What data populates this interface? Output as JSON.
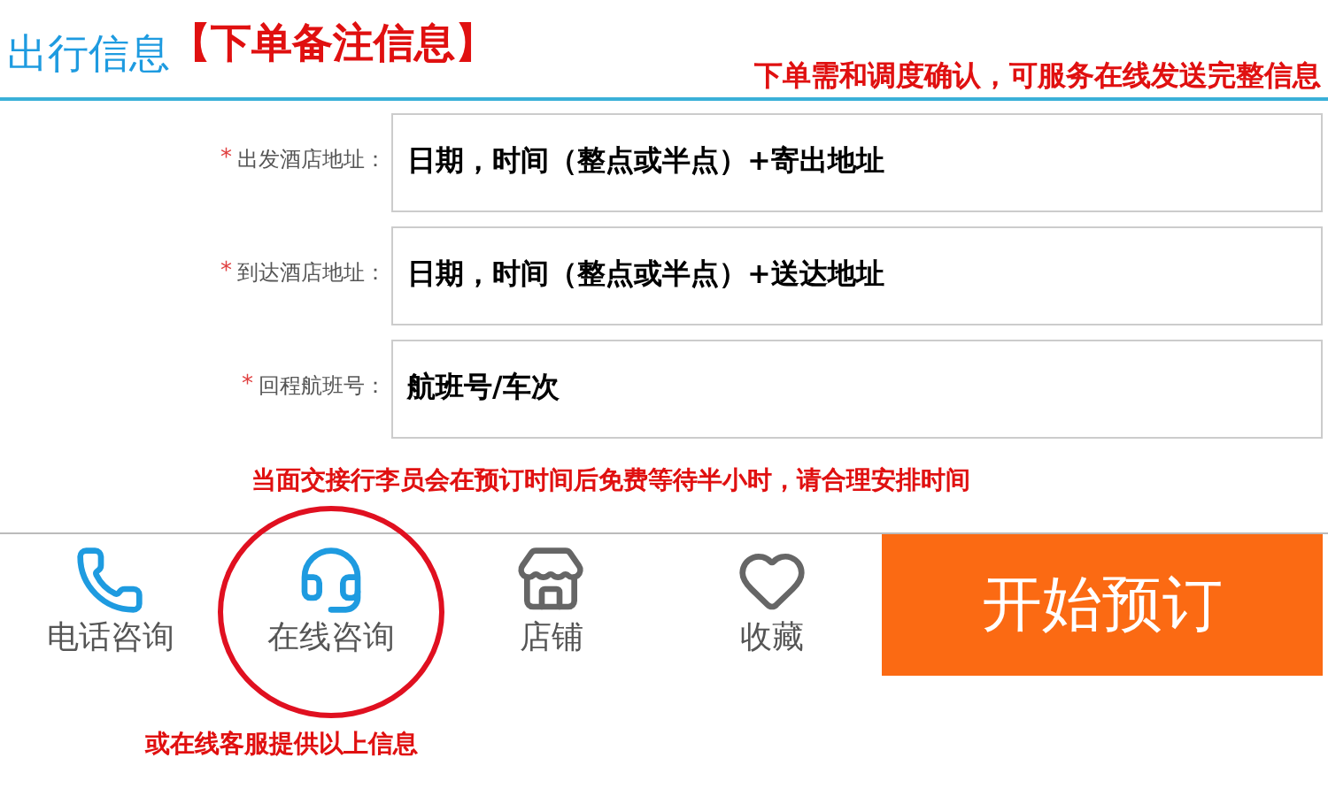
{
  "header": {
    "title": "出行信息",
    "subtitle": "【下单备注信息】",
    "note": "下单需和调度确认，可服务在线发送完整信息"
  },
  "fields": [
    {
      "required_mark": "*",
      "label": "出发酒店地址：",
      "value": "日期，时间（整点或半点）+寄出地址"
    },
    {
      "required_mark": "*",
      "label": "到达酒店地址：",
      "value": "日期，时间（整点或半点）+送达地址"
    },
    {
      "required_mark": "*",
      "label": "回程航班号：",
      "value": "航班号/车次"
    }
  ],
  "notice": "当面交接行李员会在预订时间后免费等待半小时，请合理安排时间",
  "bottom_bar": {
    "items": [
      {
        "kind": "phone",
        "label": "电话咨询",
        "circled": false
      },
      {
        "kind": "headset",
        "label": "在线咨询",
        "circled": true
      },
      {
        "kind": "store",
        "label": "店铺",
        "circled": false
      },
      {
        "kind": "heart",
        "label": "收藏",
        "circled": false
      }
    ],
    "book_button": "开始预订"
  },
  "footer_note": "或在线客服提供以上信息"
}
